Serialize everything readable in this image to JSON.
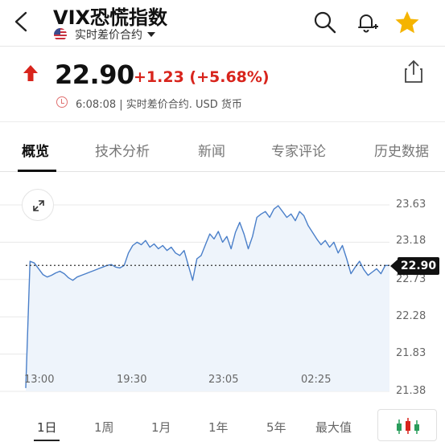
{
  "header": {
    "title": "VIX恐慌指数",
    "subtitle": "实时差价合约",
    "icons": {
      "back": "chevron-left-icon",
      "flag": "us-flag-icon",
      "search": "search-icon",
      "alert": "bell-plus-icon",
      "favorite": "star-icon"
    },
    "favorite_color": "#f5b400"
  },
  "quote": {
    "price": "22.90",
    "change": "+1.23 (+5.68%)",
    "time": "6:08:08",
    "meta": "6:08:08 | 实时差价合约. USD 货币",
    "up_color": "#d8241c"
  },
  "tabs": [
    {
      "label": "概览",
      "active": true
    },
    {
      "label": "技术分析"
    },
    {
      "label": "新闻"
    },
    {
      "label": "专家评论"
    },
    {
      "label": "历史数据"
    }
  ],
  "chart_data": {
    "type": "area",
    "current_value": "22.90",
    "y_ticks": [
      "23.63",
      "23.18",
      "22.73",
      "22.28",
      "21.83",
      "21.38"
    ],
    "ylim": [
      21.38,
      23.63
    ],
    "x_ticks": [
      "13:00",
      "19:30",
      "23:05",
      "02:25"
    ],
    "reference_line": 22.9,
    "line_color": "#4a7fc9",
    "series": [
      {
        "values": [
          21.42,
          22.95,
          22.93,
          22.86,
          22.79,
          22.76,
          22.78,
          22.81,
          22.83,
          22.8,
          22.75,
          22.72,
          22.76,
          22.78,
          22.8,
          22.82,
          22.84,
          22.86,
          22.88,
          22.9,
          22.91,
          22.88,
          22.87,
          22.9,
          23.05,
          23.14,
          23.18,
          23.15,
          23.2,
          23.12,
          23.16,
          23.1,
          23.14,
          23.08,
          23.12,
          23.05,
          23.02,
          23.08,
          22.9,
          22.72,
          22.98,
          23.02,
          23.15,
          23.28,
          23.22,
          23.31,
          23.18,
          23.25,
          23.1,
          23.3,
          23.42,
          23.28,
          23.1,
          23.25,
          23.48,
          23.52,
          23.55,
          23.48,
          23.58,
          23.62,
          23.55,
          23.48,
          23.52,
          23.44,
          23.55,
          23.5,
          23.38,
          23.3,
          23.22,
          23.15,
          23.2,
          23.12,
          23.18,
          23.05,
          23.14,
          22.98,
          22.8,
          22.88,
          22.95,
          22.85,
          22.78,
          22.82,
          22.86,
          22.8,
          22.9,
          22.9
        ]
      }
    ]
  },
  "ranges": [
    {
      "label": "1日",
      "active": true
    },
    {
      "label": "1周"
    },
    {
      "label": "1月"
    },
    {
      "label": "1年"
    },
    {
      "label": "5年"
    },
    {
      "label": "最大值"
    }
  ],
  "candle_button_icon": "candlestick-icon"
}
